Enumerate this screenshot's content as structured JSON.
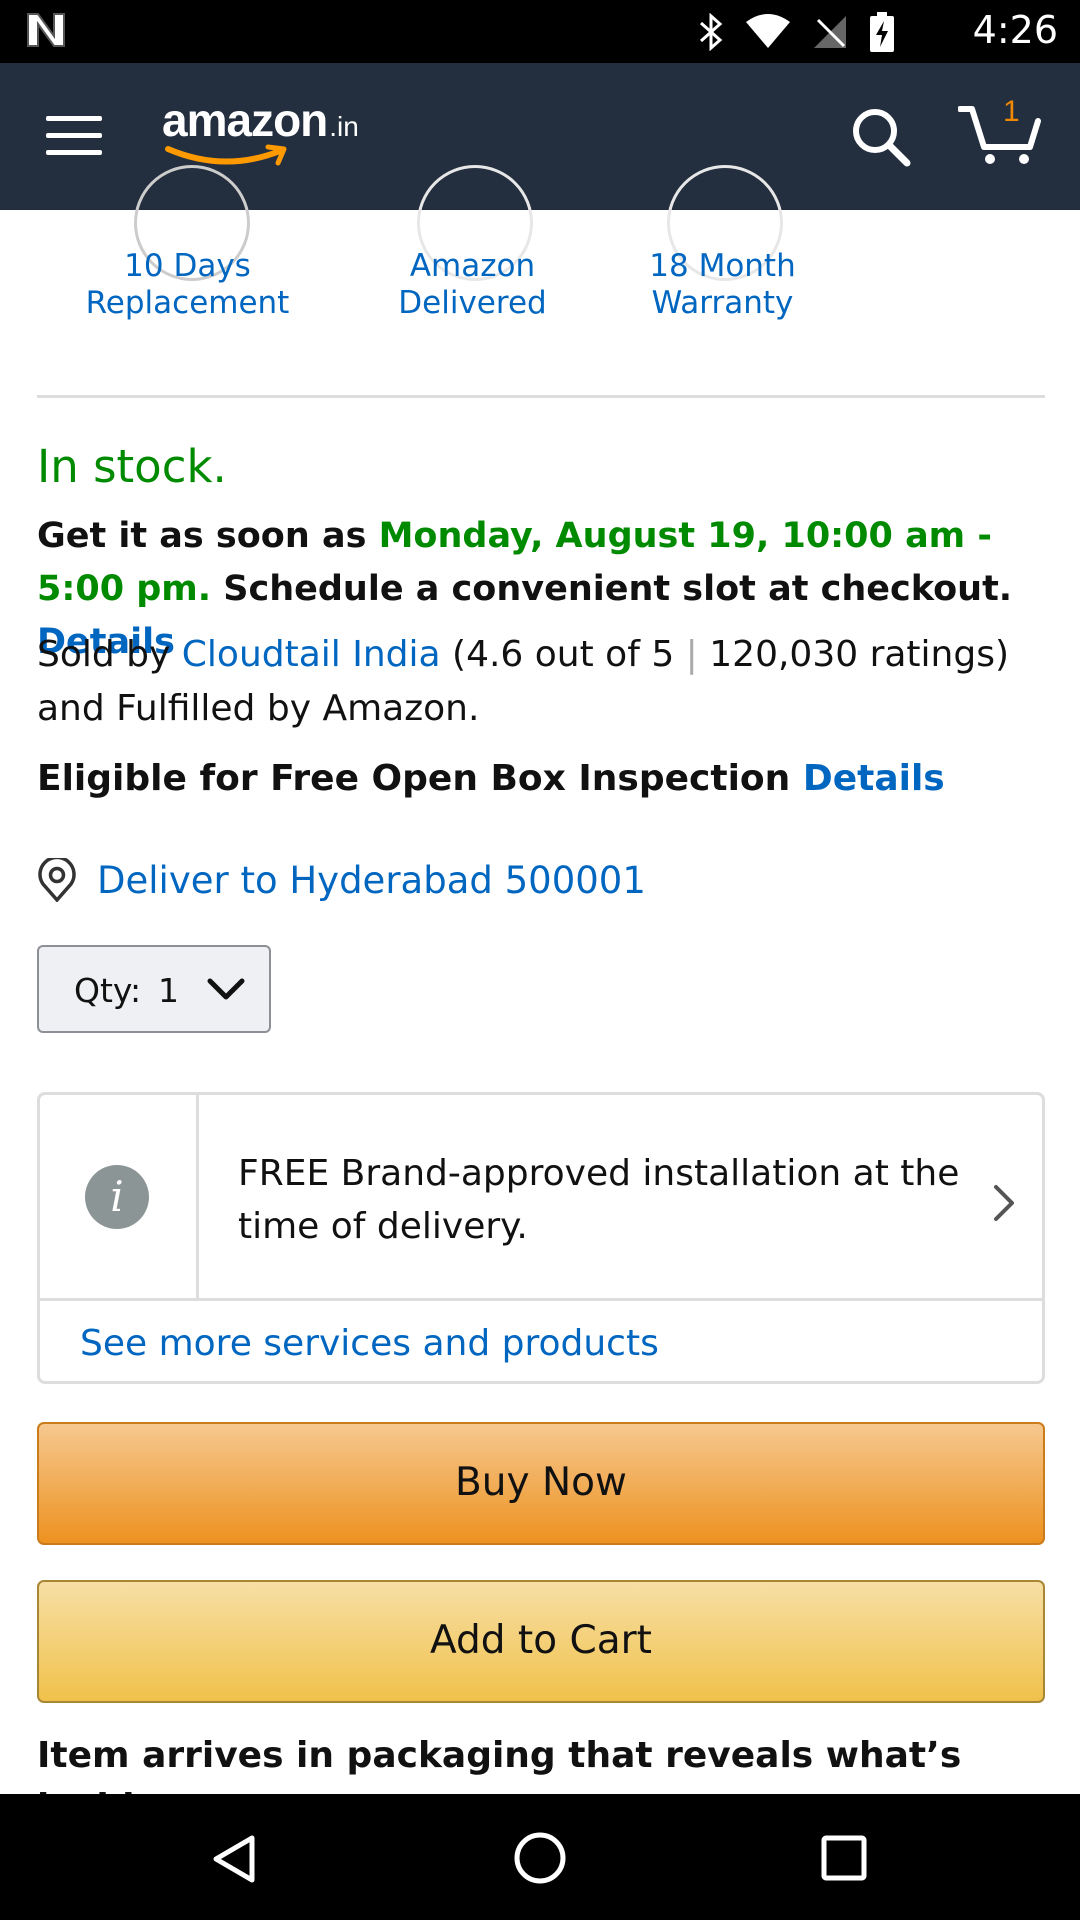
{
  "status_bar": {
    "time": "4:26"
  },
  "nav": {
    "logo_word": "amazon",
    "logo_tld": ".in",
    "cart_count": "1"
  },
  "badges": [
    {
      "label": "10 Days Replacement"
    },
    {
      "label": "Amazon Delivered"
    },
    {
      "label": "18 Month Warranty"
    }
  ],
  "availability": "In stock.",
  "delivery": {
    "prefix": "Get it as soon as ",
    "date": "Monday, August 19, 10:00 am - 5:00 pm.",
    "suffix": " Schedule a convenient slot at checkout. ",
    "details_link": "Details"
  },
  "seller": {
    "prefix": "Sold by ",
    "name": "Cloudtail India",
    "rating": " (4.6 out of 5 ",
    "pipe": "|",
    "ratings_count": " 120,030 ratings)",
    "fulfilled": " and Fulfilled by Amazon."
  },
  "open_box": {
    "text": "Eligible for Free Open Box Inspection ",
    "details_link": "Details"
  },
  "deliver_to": "Deliver to Hyderabad 500001",
  "quantity": {
    "label": "Qty:",
    "value": "1"
  },
  "service": {
    "text": "FREE Brand-approved installation at the time of delivery.",
    "see_more": "See more services and products"
  },
  "buttons": {
    "buy_now": "Buy Now",
    "add_to_cart": "Add to Cart"
  },
  "packaging_note": "Item arrives in packaging that reveals what’s inside"
}
